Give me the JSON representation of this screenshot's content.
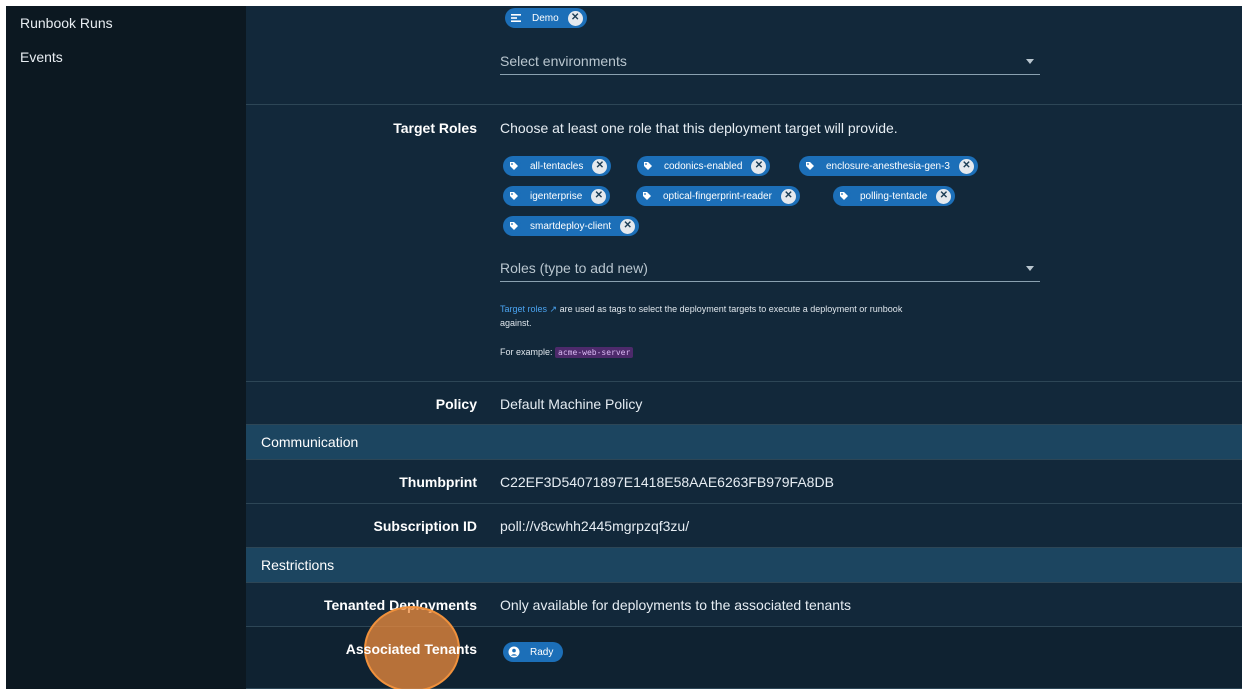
{
  "sidebar": {
    "items": [
      {
        "label": "Runbook Runs"
      },
      {
        "label": "Events"
      }
    ]
  },
  "environments": {
    "chips": [
      {
        "label": "Demo",
        "icon": "environment-icon"
      }
    ],
    "placeholder": "Select environments"
  },
  "target_roles": {
    "label": "Target Roles",
    "description": "Choose at least one role that this deployment target will provide.",
    "chips": [
      {
        "label": "all-tentacles"
      },
      {
        "label": "codonics-enabled"
      },
      {
        "label": "enclosure-anesthesia-gen-3"
      },
      {
        "label": "igenterprise"
      },
      {
        "label": "optical-fingerprint-reader"
      },
      {
        "label": "polling-tentacle"
      },
      {
        "label": "smartdeploy-client"
      }
    ],
    "placeholder": "Roles (type to add new)",
    "help_link": "Target roles",
    "help_text_1": "are used as tags to select the deployment targets to execute a deployment or runbook",
    "help_text_2": "against.",
    "example_prefix": "For example:",
    "example_code": "acme-web-server"
  },
  "policy": {
    "label": "Policy",
    "value": "Default Machine Policy"
  },
  "communication": {
    "header": "Communication",
    "thumbprint_label": "Thumbprint",
    "thumbprint_value": "C22EF3D54071897E1418E58AAE6263FB979FA8DB",
    "subscription_label": "Subscription ID",
    "subscription_value": "poll://v8cwhh2445mgrpzqf3zu/"
  },
  "restrictions": {
    "header": "Restrictions",
    "tenanted_label": "Tenanted Deployments",
    "tenanted_value": "Only available for deployments to the associated tenants",
    "tenants_label": "Associated Tenants",
    "tenant_chip": "Rady"
  },
  "colors": {
    "accent": "#1c6fb8",
    "sidebar": "#0c1821",
    "main": "#12283a",
    "section": "#1c4560",
    "cursor": "#f0913c"
  }
}
